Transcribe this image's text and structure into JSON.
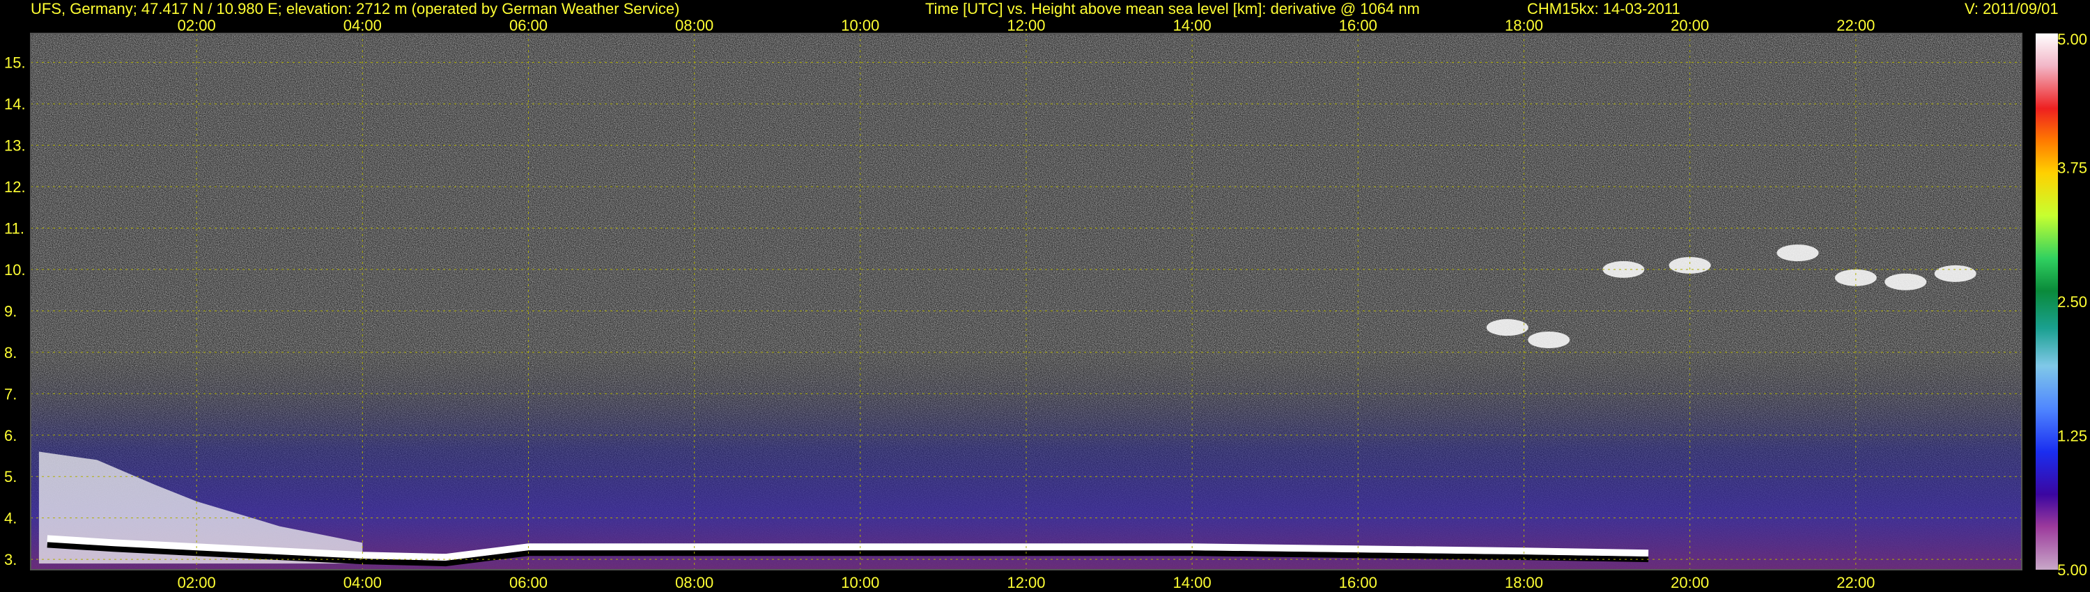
{
  "header": {
    "station": "UFS, Germany; 47.417 N / 10.980 E; elevation: 2712 m  (operated by German Weather Service)",
    "axes_desc": "Time [UTC] vs. Height above mean sea level [km]: derivative @ 1064 nm",
    "instrument": "CHM15kx: 14-03-2011",
    "version": "V: 2011/09/01"
  },
  "colors": {
    "text": "#ffff33",
    "grid": "#b0b000",
    "background": "#000000"
  },
  "chart_data": {
    "type": "heatmap",
    "x_axis": {
      "ticks": [
        "02:00",
        "04:00",
        "06:00",
        "08:00",
        "10:00",
        "12:00",
        "14:00",
        "16:00",
        "18:00",
        "20:00",
        "22:00"
      ],
      "tick_hours": [
        2,
        4,
        6,
        8,
        10,
        12,
        14,
        16,
        18,
        20,
        22
      ],
      "range": [
        0,
        24
      ]
    },
    "y_axis": {
      "ticks": [
        "3.",
        "4.",
        "5.",
        "6.",
        "7.",
        "8.",
        "9.",
        "10.",
        "11.",
        "12.",
        "13.",
        "14.",
        "15."
      ],
      "tick_values": [
        3,
        4,
        5,
        6,
        7,
        8,
        9,
        10,
        11,
        12,
        13,
        14,
        15
      ],
      "range": [
        2.75,
        15.7
      ]
    },
    "colorbar": {
      "labels": [
        "5.00",
        "3.75",
        "2.50",
        "1.25",
        "5.00"
      ],
      "label_values": [
        5.0,
        3.75,
        2.5,
        1.25,
        0.0
      ]
    },
    "grid": true,
    "features": {
      "boundary_layer_top_km": [
        [
          0.2,
          3.5
        ],
        [
          1.0,
          3.4
        ],
        [
          2.0,
          3.3
        ],
        [
          3.0,
          3.2
        ],
        [
          4.0,
          3.1
        ],
        [
          5.0,
          3.05
        ],
        [
          6.0,
          3.3
        ],
        [
          7.5,
          3.3
        ],
        [
          9.4,
          3.3
        ],
        [
          10.8,
          3.3
        ],
        [
          12.0,
          3.3
        ],
        [
          14.0,
          3.3
        ],
        [
          16.0,
          3.25
        ],
        [
          18.0,
          3.2
        ],
        [
          19.5,
          3.15
        ]
      ],
      "residual_layer_top_km": [
        [
          0.1,
          5.6
        ],
        [
          0.8,
          5.4
        ],
        [
          1.5,
          4.8
        ],
        [
          2.0,
          4.4
        ],
        [
          3.0,
          3.8
        ],
        [
          4.0,
          3.4
        ]
      ],
      "cirrus_km": [
        [
          17.8,
          8.6
        ],
        [
          18.3,
          8.3
        ],
        [
          19.2,
          10.0
        ],
        [
          20.0,
          10.1
        ],
        [
          21.3,
          10.4
        ],
        [
          22.0,
          9.8
        ],
        [
          22.6,
          9.7
        ],
        [
          23.2,
          9.9
        ]
      ]
    }
  }
}
